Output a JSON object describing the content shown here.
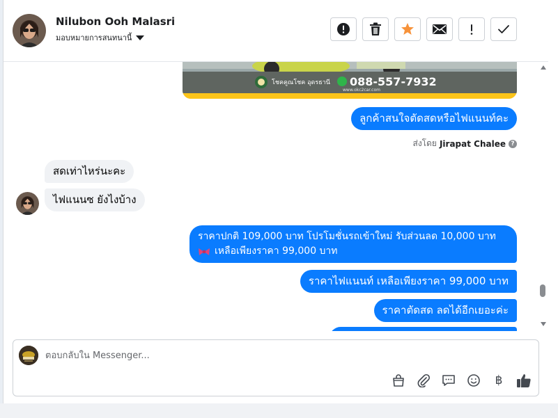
{
  "contact": {
    "name": "Nilubon Ooh Malasri",
    "assign_label": "มอบหมายการสนทนานี้"
  },
  "toolbar": {
    "buttons": [
      "exclamation-circle-icon",
      "trash-icon",
      "star-icon",
      "envelope-icon",
      "exclamation-icon",
      "checkmark-icon"
    ],
    "star_color": "#f7923a"
  },
  "ad_image": {
    "brand_text": "โชคคูณโชค อุดรธานี",
    "phone": "088-557-7932",
    "website": "www.okc2car.com"
  },
  "messages": [
    {
      "dir": "out",
      "text": "ลูกค้าสนใจตัดสดหรือไฟแนนท์คะ"
    },
    {
      "dir": "in",
      "text": "สดเท่าไหร่นะคะ"
    },
    {
      "dir": "in",
      "text": "ไฟแนนซ ยังไงบ้าง"
    },
    {
      "dir": "out",
      "line1": "ราคาปกติ 109,000 บาท  โปรโมชั่นรถเข้าใหม่ รับส่วนลด 10,000 บาท",
      "line2": "เหลือเพียงราคา 99,000 บาท",
      "emoji_icon": "ribbon-icon"
    },
    {
      "dir": "out",
      "text": "ราคาไฟแนนท์  เหลือเพียงราคา 99,000 บาท"
    },
    {
      "dir": "out",
      "text": "ราคาตัดสด ลดได้อีกเยอะค่ะ"
    }
  ],
  "sent_by": {
    "prefix": "ส่งโดย",
    "name": "Jirapat Chalee"
  },
  "composer": {
    "placeholder": "ตอบกลับใน Messenger...",
    "icons": [
      "shopping-bag-icon",
      "paperclip-icon",
      "saved-reply-icon",
      "emoji-icon",
      "baht-icon",
      "thumbs-up-icon"
    ],
    "baht_symbol": "฿"
  },
  "colors": {
    "outgoing": "#0a7cff",
    "incoming": "#f0f2f5"
  }
}
